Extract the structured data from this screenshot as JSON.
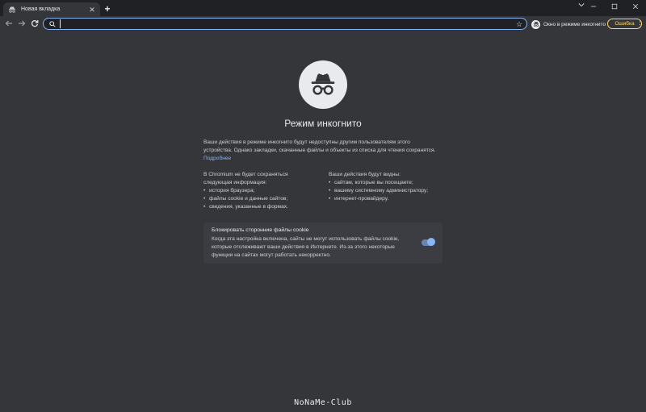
{
  "tab": {
    "title": "Новая вкладка",
    "close_label": "✕"
  },
  "toolbar": {
    "new_tab_label": "+",
    "omnibox_value": "",
    "incognito_label": "Окно в режиме инкогнито",
    "error_label": "Ошибка"
  },
  "page": {
    "title": "Режим инкогнито",
    "intro": "Ваши действия в режиме инкогнито будут недоступны другим пользователям этого устройства. Однако закладки, скачанные файлы и объекты из списка для чтения сохранятся.",
    "learn_more": "Подробнее",
    "left_heading_line1": "В Chromium не будет сохраняться",
    "left_heading_line2": "следующая информация:",
    "left_items": [
      "история браузера;",
      "файлы cookie и данные сайтов;",
      "сведения, указанные в формах."
    ],
    "right_heading": "Ваши действия будут видны:",
    "right_items": [
      "сайтам, которые вы посещаете;",
      "вашему системному администратору;",
      "интернет-провайдеру."
    ],
    "cookie_title": "Блокировать сторонние файлы cookie",
    "cookie_desc": "Когда эта настройка включена, сайты не могут использовать файлы cookie, которые отслеживают ваши действия в Интернете. Из-за этого некоторые функции на сайтах могут работать некорректно.",
    "cookie_toggle_on": true
  },
  "watermark": "NoNaMe-Club",
  "colors": {
    "accent": "#8ab4f8",
    "error": "#fdd663",
    "background": "#35363a",
    "titlebar": "#202124"
  },
  "icons": [
    "incognito-icon",
    "close-icon",
    "plus-icon",
    "chevron-down-icon",
    "minimize-icon",
    "maximize-icon",
    "window-close-icon",
    "back-icon",
    "forward-icon",
    "reload-icon",
    "search-icon",
    "star-icon",
    "more-icon"
  ]
}
